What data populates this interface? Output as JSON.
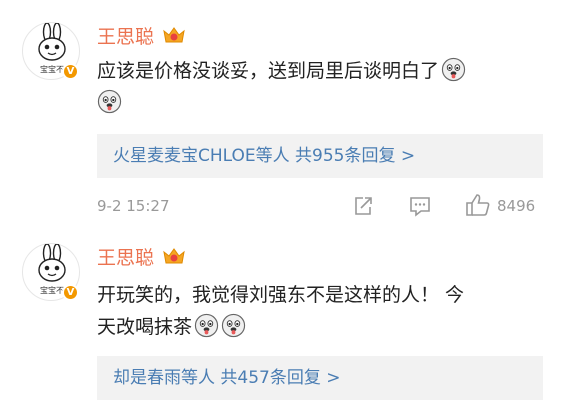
{
  "comments": [
    {
      "username": "王思聪",
      "avatar_caption": "宝宝不",
      "text_line1": "应该是价格没谈妥，送到局里后谈明白了",
      "reply_summary": "火星麦麦宝CHLOE等人  共955条回复 >",
      "time": "9-2 15:27",
      "likes": "8496"
    },
    {
      "username": "王思聪",
      "avatar_caption": "宝宝不",
      "text_line1": "开玩笑的，我觉得刘强东不是这样的人！ 今",
      "text_line2": "天改喝抹茶",
      "reply_summary": "却是春雨等人  共457条回复 >"
    }
  ],
  "icons": {
    "crown": "crown-badge-icon",
    "verified": "verified-v-icon",
    "emoji": "doge-emoji-icon",
    "share": "share-icon",
    "comment": "comment-icon",
    "like": "thumbs-up-icon"
  },
  "colors": {
    "username": "#eb7350",
    "link": "#4a7db3",
    "meta": "#999999",
    "reply_bg": "#f2f2f2",
    "verified": "#f39800"
  }
}
